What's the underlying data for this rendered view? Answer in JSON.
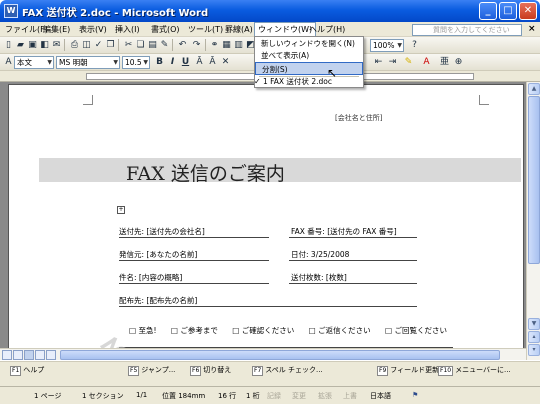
{
  "window": {
    "title": "FAX 送付状 2.doc - Microsoft Word",
    "min": "_",
    "max": "□",
    "close": "✕"
  },
  "menubar": {
    "items": [
      "ファイル(F)",
      "編集(E)",
      "表示(V)",
      "挿入(I)",
      "書式(O)",
      "ツール(T)",
      "罫線(A)",
      "ウィンドウ(W)",
      "ヘルプ(H)"
    ],
    "help_placeholder": "質問を入力してください",
    "close": "×"
  },
  "toolbar1": {
    "zoom": "100%",
    "help_icon": "?"
  },
  "toolbar2": {
    "style": "本文",
    "font": "MS 明朝",
    "size": "10.5",
    "bold": "B",
    "italic": "I",
    "underline": "U"
  },
  "dropdown": {
    "items": [
      "新しいウィンドウを開く(N)",
      "並べて表示(A)",
      "分割(S)",
      "1 FAX 送付状 2.doc"
    ],
    "checked_index": 3,
    "highlighted_index": 2
  },
  "document": {
    "company_tag": "[会社名と住所]",
    "title": "FAX 送信のご案内",
    "rows": [
      {
        "label": "送付先:",
        "value": "[送付先の会社名]",
        "label2": "FAX 番号:",
        "value2": "[送付先の FAX 番号]"
      },
      {
        "label": "発信元:",
        "value": "[あなたの名前]",
        "label2": "日付:",
        "value2": "3/25/2008"
      },
      {
        "label": "件名:",
        "value": "[内容の概略]",
        "label2": "送付枚数:",
        "value2": "[枚数]"
      },
      {
        "label": "配布先:",
        "value": "[配布先の名前]",
        "label2": "",
        "value2": ""
      }
    ],
    "checkboxes": [
      "□ 至急!",
      "□ ご参考まで",
      "□ ご確認ください",
      "□ ご返信ください",
      "□ ご回覧ください"
    ]
  },
  "fkeys": [
    {
      "key": "F1",
      "label": "ヘルプ",
      "dim": false
    },
    {
      "key": "F5",
      "label": "ジャンプ...",
      "dim": false
    },
    {
      "key": "F6",
      "label": "切り替え",
      "dim": false
    },
    {
      "key": "F7",
      "label": "スペル チェック...",
      "dim": false
    },
    {
      "key": "F9",
      "label": "フィールド更新",
      "dim": false
    },
    {
      "key": "F10",
      "label": "メニューバーに...",
      "dim": false
    }
  ],
  "statusbar": {
    "page": "1 ページ",
    "section": "1 セクション",
    "pages": "1/1",
    "position": "位置 184mm",
    "line": "16 行",
    "col": "1 桁",
    "rec": "記録",
    "trk": "変更",
    "ext": "拡張",
    "ovr": "上書",
    "lang": "日本語"
  }
}
